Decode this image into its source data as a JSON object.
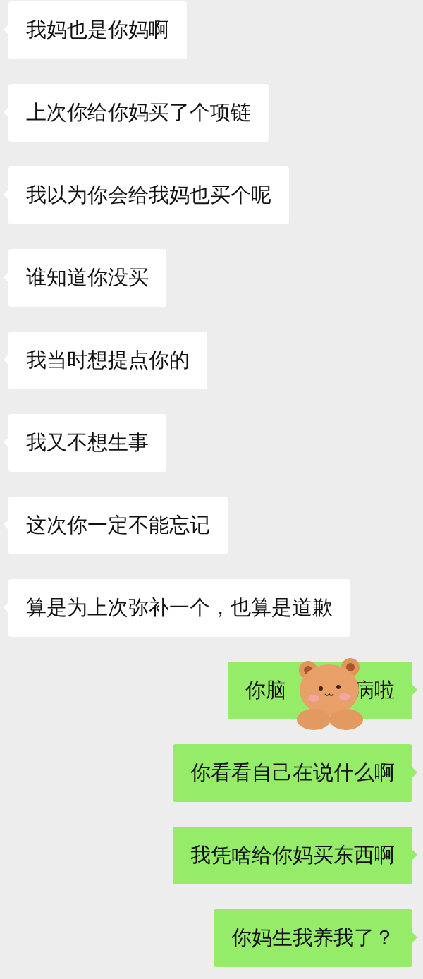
{
  "messages": [
    {
      "kind": "received",
      "text": "我妈也是你妈啊"
    },
    {
      "kind": "received",
      "text": "上次你给你妈买了个项链"
    },
    {
      "kind": "received",
      "text": "我以为你会给我妈也买个呢"
    },
    {
      "kind": "received",
      "text": "谁知道你没买"
    },
    {
      "kind": "received",
      "text": "我当时想提点你的"
    },
    {
      "kind": "received",
      "text": "我又不想生事"
    },
    {
      "kind": "received",
      "text": "这次你一定不能忘记"
    },
    {
      "kind": "received",
      "text": "算是为上次弥补一个，也算是道歉"
    },
    {
      "kind": "sent",
      "sticker_over": true,
      "text_before": "你脑",
      "text_after": "病啦"
    },
    {
      "kind": "sent",
      "text": "你看看自己在说什么啊"
    },
    {
      "kind": "sent",
      "text": "我凭啥给你妈买东西啊"
    },
    {
      "kind": "sent",
      "text": "你妈生我养我了？"
    }
  ]
}
